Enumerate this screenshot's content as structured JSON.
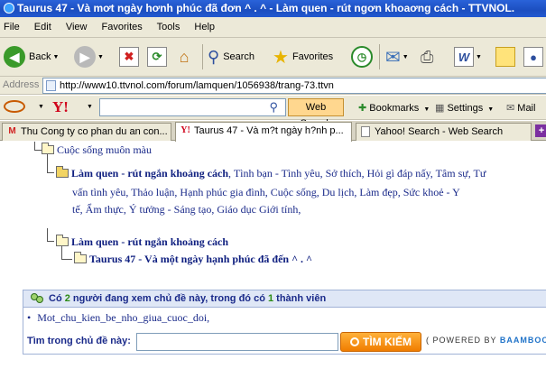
{
  "window": {
    "title": "Taurus 47 - Và mơt ngày hơnh phúc đã đơn ^ . ^ - Làm quen - rút ngơn khoaơng cách - TTVNOL."
  },
  "menu": [
    "File",
    "Edit",
    "View",
    "Favorites",
    "Tools",
    "Help"
  ],
  "toolbar": {
    "back_label": "Back",
    "search_label": "Search",
    "favorites_label": "Favorites"
  },
  "address": {
    "label": "Address",
    "url": "http://www10.ttvnol.com/forum/lamquen/1056938/trang-73.ttvn"
  },
  "yahoo_toolbar": {
    "web_search_label": "Web Search",
    "bookmarks_label": "Bookmarks",
    "settings_label": "Settings",
    "mail_label": "Mail"
  },
  "tabs": [
    {
      "label": "Thu Cong ty co phan du an con...",
      "icon": "gmail-icon"
    },
    {
      "label": "Taurus 47 - Và m?t ngày h?nh p...",
      "icon": "yahoo-icon"
    },
    {
      "label": "Yahoo! Search - Web Search",
      "icon": "page-icon"
    }
  ],
  "tree": {
    "root": "Cuộc sống muôn màu",
    "category": {
      "name": "Làm quen - rút ngắn khoảng cách",
      "desc_line1": ", Tình bạn - Tình yêu, Sở thích, Hỏi gì đáp nấy, Tâm sự, Tư",
      "desc_line2": "vấn tình yêu, Thảo luận, Hạnh phúc gia đình, Cuộc sống, Du lịch, Làm đẹp, Sức khoẻ - Y",
      "desc_line3": "tế, Ẩm thực, Ý tưởng - Sáng tạo, Giáo dục Giới tính,"
    },
    "breadcrumb_forum": "Làm quen - rút ngắn khoảng cách",
    "breadcrumb_topic": "Taurus 47 - Và một ngày hạnh phúc đã đến ^ . ^"
  },
  "viewers": {
    "prefix": "Có",
    "count": "2",
    "middle": "người đang xem chủ đề này, trong đó có",
    "members": "1",
    "suffix": "thành viên",
    "member_name": "Mot_chu_kien_be_nho_giua_cuoc_doi",
    "member_sep": ","
  },
  "find": {
    "label": "Tìm trong chủ đề này:",
    "button": "TÌM KIẾM",
    "powered_prefix": "( POWERED BY",
    "powered_brand": "BAAMBOO"
  }
}
